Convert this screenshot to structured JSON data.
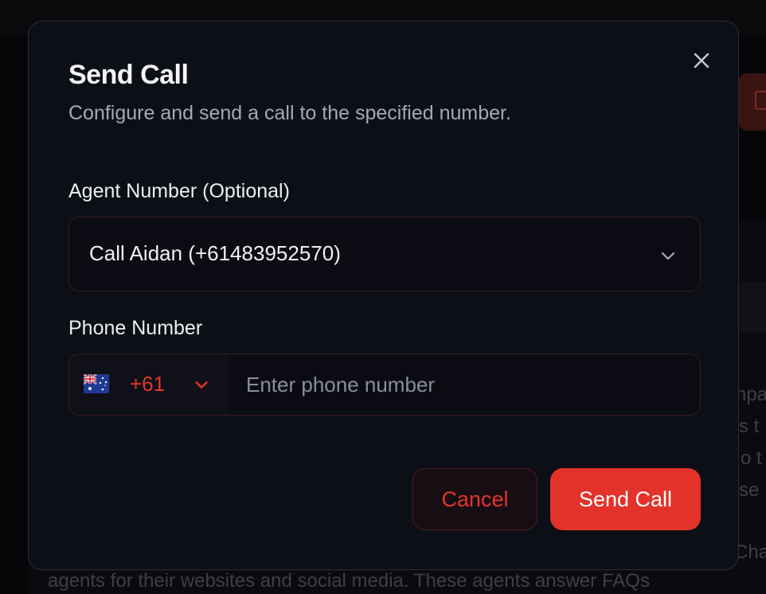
{
  "background": {
    "text_fragments": [
      "npa",
      "s t",
      "o t",
      "se",
      "Cha"
    ],
    "bottom_text": "agents for their websites and social media. These agents answer FAQs"
  },
  "modal": {
    "title": "Send Call",
    "description": "Configure and send a call to the specified number.",
    "close_icon": "close-icon"
  },
  "agent_number": {
    "label": "Agent Number (Optional)",
    "selected_value": "Call Aidan (+61483952570)",
    "chevron_icon": "chevron-down-icon"
  },
  "phone_number": {
    "label": "Phone Number",
    "country_flag": "australia-flag-icon",
    "dial_code": "+61",
    "value": "",
    "placeholder": "Enter phone number"
  },
  "actions": {
    "cancel_label": "Cancel",
    "send_label": "Send Call"
  },
  "colors": {
    "accent": "#e3322a",
    "modal_bg": "#0d0f17",
    "border_accent": "#3a1a1e",
    "title_text": "#f4f4f6",
    "muted_text": "#a6a9b4"
  }
}
